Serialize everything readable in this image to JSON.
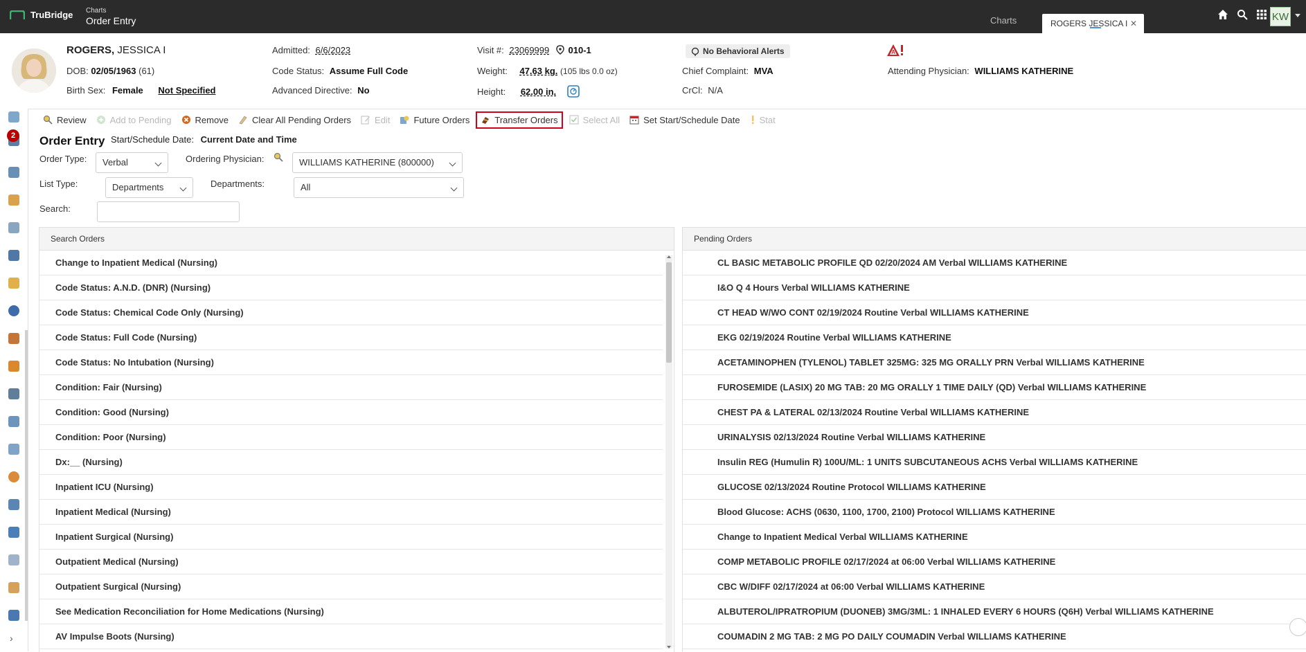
{
  "app": {
    "brand": "TruBridge",
    "crumb_parent": "Charts",
    "crumb_title": "Order Entry",
    "tab_charts": "Charts",
    "tab_patient": "ROGERS JESSICA I",
    "tab_close": "✕",
    "user_initials": "KW"
  },
  "patient": {
    "last_name": "ROGERS,",
    "first_name": "JESSICA I",
    "dob_label": "DOB:",
    "dob": "02/05/1963",
    "age": "(61)",
    "sex_label": "Birth Sex:",
    "sex": "Female",
    "gender_identity": "Not Specified",
    "admitted_label": "Admitted:",
    "admitted": "6/6/2023",
    "code_status_label": "Code Status:",
    "code_status": "Assume Full Code",
    "adv_directive_label": "Advanced Directive:",
    "adv_directive": "No",
    "visit_label": "Visit #:",
    "visit": "23069999",
    "room": "010-1",
    "weight_label": "Weight:",
    "weight": "47.63 kg.",
    "weight_alt": "(105 lbs 0.0 oz)",
    "height_label": "Height:",
    "height": "62.00 in.",
    "behavioral_alert": "No Behavioral Alerts",
    "complaint_label": "Chief Complaint:",
    "complaint": "MVA",
    "crcl_label": "CrCl:",
    "crcl": "N/A",
    "attending_label": "Attending Physician:",
    "attending": "WILLIAMS KATHERINE"
  },
  "rail": {
    "badge_count": "2",
    "expand": "›"
  },
  "toolbar": {
    "review": "Review",
    "add_pending": "Add to Pending",
    "remove": "Remove",
    "clear_pending": "Clear All Pending Orders",
    "edit": "Edit",
    "future_orders": "Future Orders",
    "transfer_orders": "Transfer Orders",
    "select_all": "Select All",
    "set_start": "Set Start/Schedule Date",
    "stat": "Stat"
  },
  "form": {
    "title": "Order Entry",
    "start_label": "Start/Schedule Date:",
    "start_value": "Current Date and Time",
    "order_type_label": "Order Type:",
    "order_type": "Verbal",
    "ordering_physician_label": "Ordering Physician:",
    "ordering_physician": "WILLIAMS KATHERINE (800000)",
    "list_type_label": "List Type:",
    "list_type": "Departments",
    "departments_label": "Departments:",
    "departments": "All",
    "search_label": "Search:",
    "search_value": ""
  },
  "search_orders": {
    "header": "Search Orders",
    "items": [
      "Change to Inpatient Medical (Nursing)",
      "Code Status: A.N.D. (DNR) (Nursing)",
      "Code Status: Chemical Code Only (Nursing)",
      "Code Status: Full Code (Nursing)",
      "Code Status: No Intubation (Nursing)",
      "Condition: Fair (Nursing)",
      "Condition: Good (Nursing)",
      "Condition: Poor (Nursing)",
      "Dx:__ (Nursing)",
      "Inpatient ICU (Nursing)",
      "Inpatient Medical (Nursing)",
      "Inpatient Surgical (Nursing)",
      "Outpatient Medical (Nursing)",
      "Outpatient Surgical (Nursing)",
      "See Medication Reconciliation for Home Medications (Nursing)",
      "AV Impulse Boots (Nursing)"
    ]
  },
  "pending_orders": {
    "header": "Pending Orders",
    "items": [
      "CL BASIC METABOLIC PROFILE QD 02/20/2024 AM Verbal WILLIAMS KATHERINE",
      "I&O Q 4 Hours Verbal WILLIAMS KATHERINE",
      "CT HEAD W/WO CONT 02/19/2024 Routine Verbal WILLIAMS KATHERINE",
      "EKG 02/19/2024 Routine Verbal WILLIAMS KATHERINE",
      "ACETAMINOPHEN (TYLENOL) TABLET 325MG: 325 MG ORALLY PRN Verbal WILLIAMS KATHERINE",
      "FUROSEMIDE (LASIX) 20 MG TAB: 20 MG ORALLY 1 TIME DAILY (QD) Verbal WILLIAMS KATHERINE",
      "CHEST PA & LATERAL 02/13/2024 Routine Verbal WILLIAMS KATHERINE",
      "URINALYSIS 02/13/2024 Routine Verbal WILLIAMS KATHERINE",
      "Insulin REG (Humulin R) 100U/ML: 1 UNITS SUBCUTANEOUS ACHS Verbal WILLIAMS KATHERINE",
      "GLUCOSE 02/13/2024 Routine Protocol WILLIAMS KATHERINE",
      "Blood Glucose: ACHS (0630, 1100, 1700, 2100) Protocol WILLIAMS KATHERINE",
      "Change to Inpatient Medical Verbal WILLIAMS KATHERINE",
      "COMP METABOLIC PROFILE 02/17/2024 at 06:00 Verbal WILLIAMS KATHERINE",
      "CBC W/DIFF 02/17/2024 at 06:00 Verbal WILLIAMS KATHERINE",
      "ALBUTEROL/IPRATROPIUM (DUONEB) 3MG/3ML: 1 INHALED EVERY 6 HOURS (Q6H) Verbal WILLIAMS KATHERINE",
      "COUMADIN 2 MG TAB: 2 MG PO DAILY COUMADIN Verbal WILLIAMS KATHERINE"
    ]
  },
  "colors": {
    "topbar": "#2b2b2b",
    "brand_green": "#3cb371",
    "highlight_red": "#d0021b",
    "alert_red": "#c0282d"
  }
}
